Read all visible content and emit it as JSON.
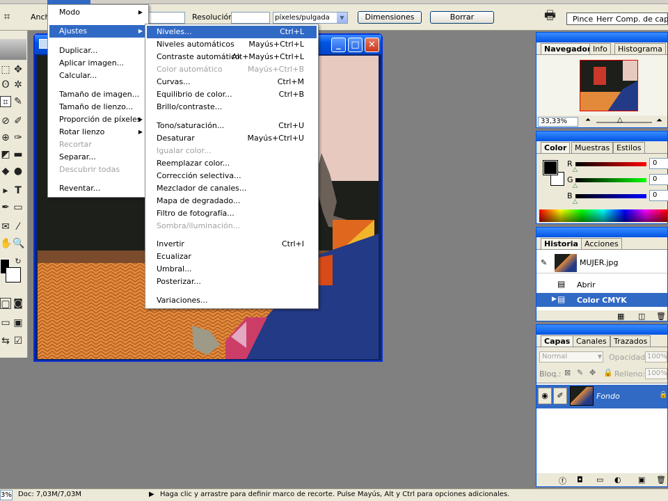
{
  "options_bar": {
    "width_label": "Anch",
    "resolution_label": "Resolución:",
    "units_value": "píxeles/pulgada",
    "dimensions_button": "Dimensiones",
    "clear_button": "Borrar",
    "dock_tabs": [
      "Pince",
      "Herr",
      "Comp. de capas"
    ]
  },
  "image_menu": {
    "items": [
      {
        "label": "Modo",
        "submenu": true
      },
      {
        "label": "Ajustes",
        "submenu": true,
        "selected": true
      },
      {
        "label": "Duplicar..."
      },
      {
        "label": "Aplicar imagen..."
      },
      {
        "label": "Calcular..."
      },
      {
        "label": "Tamaño de imagen..."
      },
      {
        "label": "Tamaño de lienzo..."
      },
      {
        "label": "Proporción de píxeles",
        "submenu": true
      },
      {
        "label": "Rotar lienzo",
        "submenu": true
      },
      {
        "label": "Recortar",
        "disabled": true
      },
      {
        "label": "Separar..."
      },
      {
        "label": "Descubrir todas",
        "disabled": true
      },
      {
        "label": "Reventar..."
      }
    ]
  },
  "adjust_menu": {
    "items": [
      {
        "label": "Niveles...",
        "shortcut": "Ctrl+L",
        "selected": true
      },
      {
        "label": "Niveles automáticos",
        "shortcut": "Mayús+Ctrl+L"
      },
      {
        "label": "Contraste automático",
        "shortcut": "Alt+Mayús+Ctrl+L"
      },
      {
        "label": "Color automático",
        "shortcut": "Mayús+Ctrl+B",
        "disabled": true
      },
      {
        "label": "Curvas...",
        "shortcut": "Ctrl+M"
      },
      {
        "label": "Equilibrio de color...",
        "shortcut": "Ctrl+B"
      },
      {
        "label": "Brillo/contraste..."
      },
      {
        "label": "Tono/saturación...",
        "shortcut": "Ctrl+U"
      },
      {
        "label": "Desaturar",
        "shortcut": "Mayús+Ctrl+U"
      },
      {
        "label": "Igualar color...",
        "disabled": true
      },
      {
        "label": "Reemplazar color..."
      },
      {
        "label": "Corrección selectiva..."
      },
      {
        "label": "Mezclador de canales..."
      },
      {
        "label": "Mapa de degradado..."
      },
      {
        "label": "Filtro de fotografía..."
      },
      {
        "label": "Sombra/iluminación...",
        "disabled": true
      },
      {
        "label": "Invertir",
        "shortcut": "Ctrl+I"
      },
      {
        "label": "Ecualizar"
      },
      {
        "label": "Umbral..."
      },
      {
        "label": "Posterizar..."
      },
      {
        "label": "Variaciones..."
      }
    ]
  },
  "navigator": {
    "tabs": [
      "Navegador",
      "Info",
      "Histograma"
    ],
    "zoom": "33,33%"
  },
  "color_panel": {
    "tabs": [
      "Color",
      "Muestras",
      "Estilos"
    ],
    "r_label": "R",
    "g_label": "G",
    "b_label": "B",
    "r_value": "0",
    "g_value": "0",
    "b_value": "0",
    "foreground_color": "#000000",
    "background_color": "#ffffff"
  },
  "history_panel": {
    "tabs": [
      "Historia",
      "Acciones"
    ],
    "snapshot": "MUJER.jpg",
    "steps": [
      "Abrir",
      "Color CMYK"
    ]
  },
  "layers_panel": {
    "tabs": [
      "Capas",
      "Canales",
      "Trazados"
    ],
    "blend_mode": "Normal",
    "opacity_label": "Opacidad:",
    "opacity_value": "100%",
    "lock_label": "Bloq.:",
    "fill_label": "Relleno:",
    "fill_value": "100%",
    "layer_name": "Fondo"
  },
  "status_bar": {
    "zoom": "3%",
    "doc": "Doc: 7,03M/7,03M",
    "hint": "Haga clic y arrastre para definir marco de recorte. Pulse Mayús, Alt y Ctrl para opciones adicionales."
  },
  "colors": {
    "accent": "#316ac5",
    "title_blue": "#0054e3",
    "panel_bg": "#ece9d8",
    "workspace": "#808080"
  }
}
